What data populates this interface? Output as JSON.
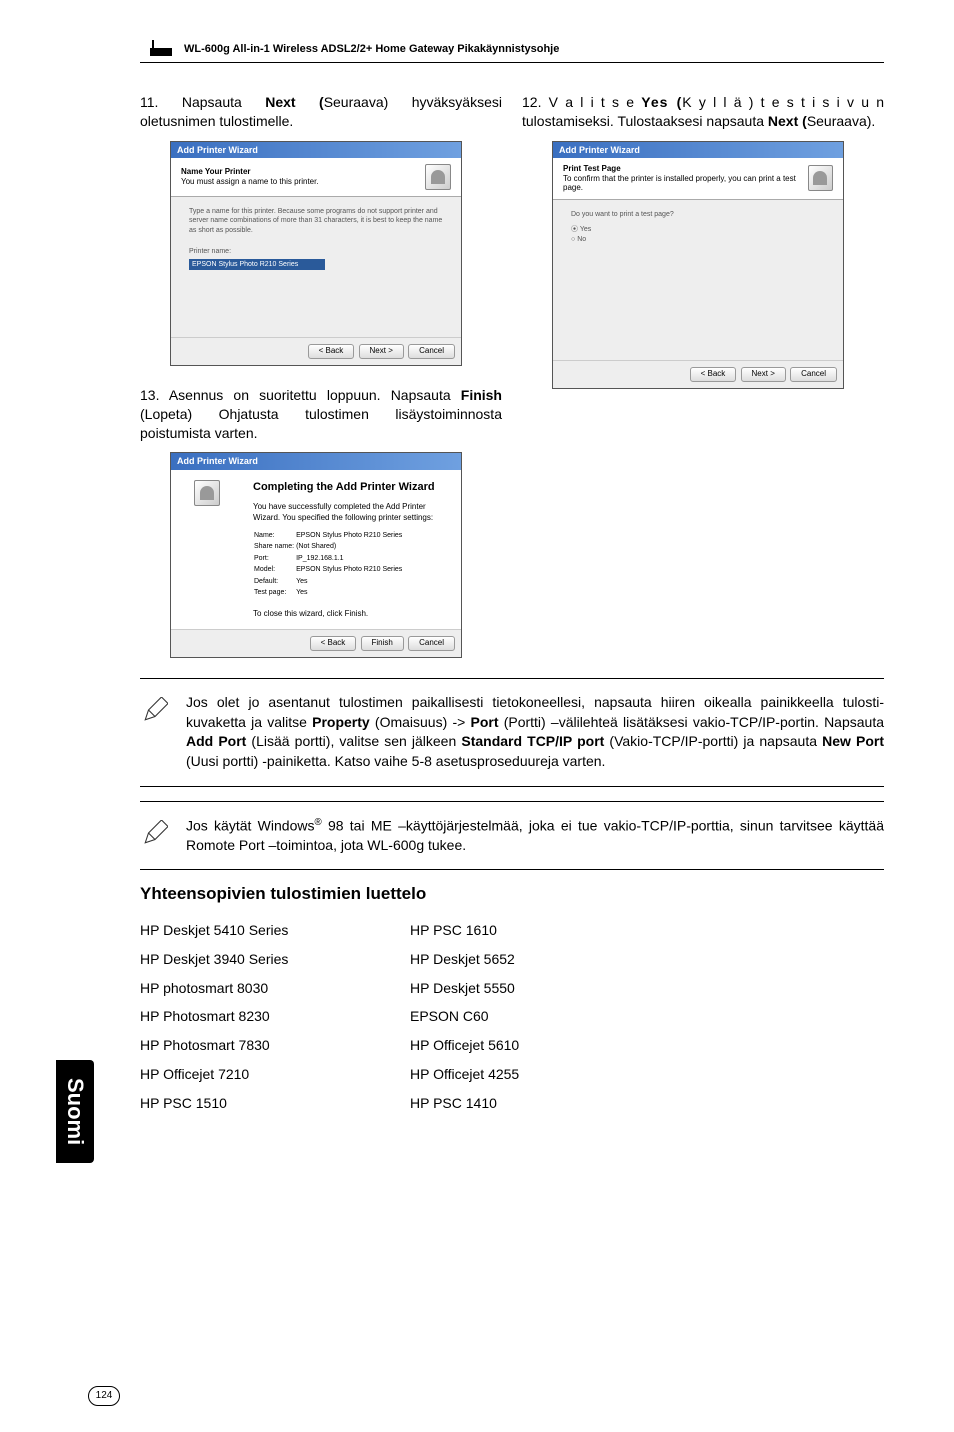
{
  "header": "WL-600g All-in-1 Wireless ADSL2/2+ Home Gateway Pikakäynnistysohje",
  "step11": {
    "prefix": "11. Napsauta ",
    "next": "Next (",
    "rest": "Seuraava) hyväksyäksesi oletusnimen tulostimelle."
  },
  "step12": {
    "prefix": "12. V a l i t s e  ",
    "yes": "Yes (",
    "mid": "K y l l ä )  t e s t i s i v u n tulostamiseksi. Tulostaaksesi napsauta ",
    "next": "Next (",
    "rest": "Seuraava)."
  },
  "step13": {
    "prefix": "13. Asennus on suoritettu loppuun. Napsauta ",
    "finish": "Finish",
    "rest": " (Lopeta) Ohjatusta tulostimen lisäystoiminnosta  poistumista varten."
  },
  "wiz": {
    "title": "Add Printer Wizard",
    "h1_bold": "Name Your Printer",
    "h1_sub": "You must assign a name to this printer.",
    "body1a": "Type a name for this printer. Because some programs do not support printer and server name combinations of more than 31 characters, it is best to keep the name as short as possible.",
    "body1_label": "Printer name:",
    "body1_value": "EPSON Stylus Photo R210 Series",
    "h2_bold": "Print Test Page",
    "h2_sub": "To confirm that the printer is installed properly, you can print a test page.",
    "body2_q": "Do you want to print a test page?",
    "yes": "Yes",
    "no": "No",
    "comp_title": "Completing the Add Printer Wizard",
    "comp_sub": "You have successfully completed the Add Printer Wizard. You specified the following printer settings:",
    "rows": {
      "name_l": "Name:",
      "name_v": "EPSON Stylus Photo R210 Series",
      "share_l": "Share name:",
      "share_v": "(Not Shared)",
      "port_l": "Port:",
      "port_v": "IP_192.168.1.1",
      "model_l": "Model:",
      "model_v": "EPSON Stylus Photo R210 Series",
      "def_l": "Default:",
      "def_v": "Yes",
      "test_l": "Test page:",
      "test_v": "Yes"
    },
    "comp_close": "To close this wizard, click Finish.",
    "btn_back": "< Back",
    "btn_next": "Next >",
    "btn_finish": "Finish",
    "btn_cancel": "Cancel"
  },
  "note1": {
    "t1": "Jos olet jo asentanut tulostimen paikallisesti tietokoneellesi, napsauta hiiren oikealla painikkeella tulosti-kuvaketta ja valitse ",
    "b1": "Property",
    "t2": " (Omaisuus) -> ",
    "b2": "Port",
    "t3": " (Portti) –välilehteä lisätäksesi vakio-TCP/IP-portin. Napsauta ",
    "b3": "Add Port",
    "t4": " (Lisää portti), valitse sen jälkeen ",
    "b4": "Standard TCP/IP port",
    "t5": " (Vakio-TCP/IP-portti) ja napsauta ",
    "b5": "New Port",
    "t6": " (Uusi portti) -painiketta. Katso vaihe 5-8 asetusproseduureja varten."
  },
  "note2": {
    "t1": "Jos käytät Windows",
    "sup": "®",
    "t2": " 98 tai ME –käyttöjärjestelmää, joka ei tue vakio-TCP/IP-porttia, sinun tarvitsee käyttää Romote Port –toimintoa, jota WL-600g tukee."
  },
  "section_heading": "Yhteensopivien tulostimien luettelo",
  "printers_left": [
    "HP Deskjet 5410 Series",
    "HP Deskjet 3940 Series",
    "HP photosmart 8030",
    "HP Photosmart 8230",
    "HP Photosmart 7830",
    "HP Officejet  7210",
    "HP PSC 1510"
  ],
  "printers_right": [
    "HP PSC 1610",
    "HP Deskjet 5652",
    "HP Deskjet 5550",
    "EPSON C60",
    "HP Officejet 5610",
    "HP Officejet 4255",
    "HP  PSC 1410"
  ],
  "side_tab": "Suomi",
  "page_number": "124"
}
